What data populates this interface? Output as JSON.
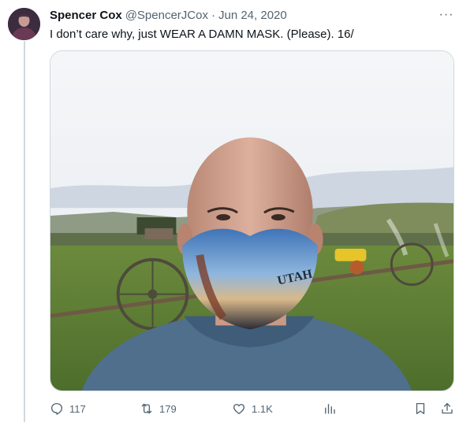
{
  "tweet": {
    "author_name": "Spencer Cox",
    "author_handle": "@SpencerJCox",
    "separator": "·",
    "date": "Jun 24, 2020",
    "text": "I don’t care why, just WEAR A DAMN MASK. (Please). 16/",
    "more_icon": "ellipsis-icon"
  },
  "media": {
    "description_icon": "photo",
    "mask_text": "UTAH"
  },
  "actions": {
    "reply_count": "117",
    "retweet_count": "179",
    "like_count": "1.1K",
    "icons": [
      "reply-icon",
      "retweet-icon",
      "like-icon",
      "views-icon",
      "bookmark-icon",
      "share-icon"
    ]
  },
  "colors": {
    "text_primary": "#0f1419",
    "text_secondary": "#536471",
    "border": "#cfd9de"
  }
}
